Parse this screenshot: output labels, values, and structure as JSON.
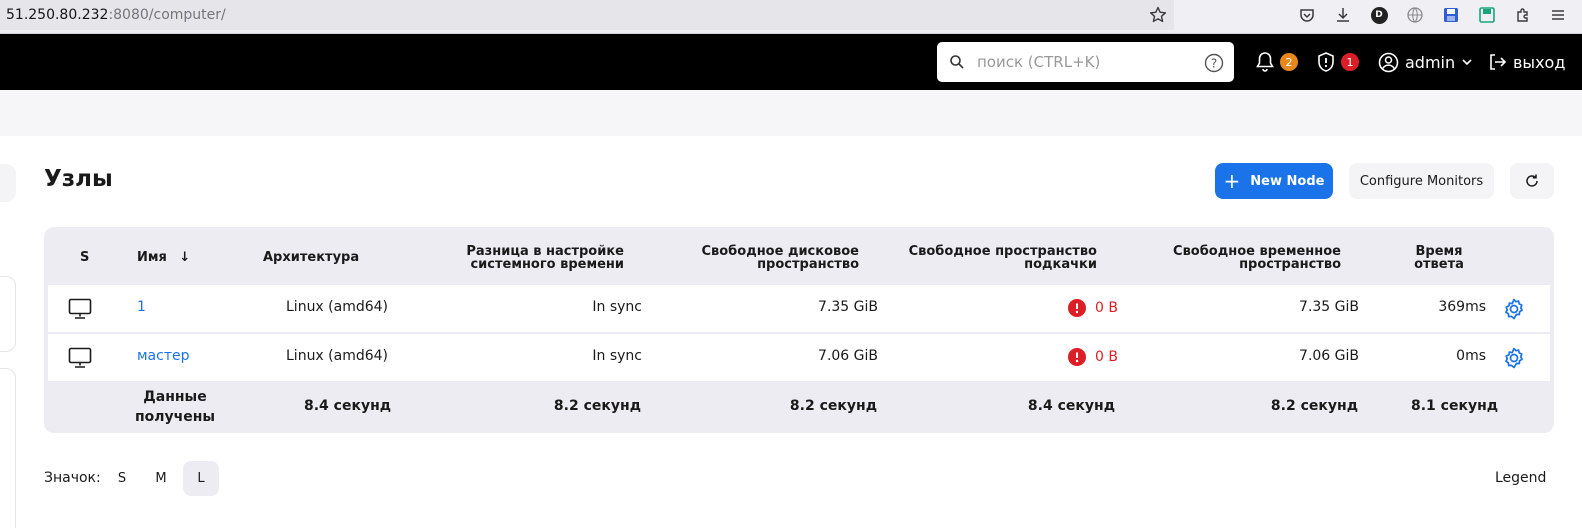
{
  "browser": {
    "url_host": "51.250.80.232",
    "url_rest": ":8080/computer/",
    "ext_d_label": "D"
  },
  "header": {
    "search_placeholder": "поиск (CTRL+K)",
    "notifications_count": "2",
    "security_count": "1",
    "user_label": "admin",
    "logout_label": "выход"
  },
  "page": {
    "title": "Узлы",
    "new_node_label": "New Node",
    "configure_monitors_label": "Configure Monitors"
  },
  "table": {
    "headers": {
      "status": "S",
      "name": "Имя",
      "sort_arrow": "↓",
      "architecture": "Архитектура",
      "clock_diff_1": "Разница в настройке",
      "clock_diff_2": "системного времени",
      "disk_1": "Свободное дисковое",
      "disk_2": "пространство",
      "swap_1": "Свободное пространство",
      "swap_2": "подкачки",
      "temp_1": "Свободное временное",
      "temp_2": "пространство",
      "response_1": "Время",
      "response_2": "ответа"
    },
    "rows": [
      {
        "name": "1",
        "architecture": "Linux (amd64)",
        "clock": "In sync",
        "disk": "7.35 GiB",
        "swap": "0 B",
        "temp": "7.35 GiB",
        "response": "369ms"
      },
      {
        "name": "мастер",
        "architecture": "Linux (amd64)",
        "clock": "In sync",
        "disk": "7.06 GiB",
        "swap": "0 B",
        "temp": "7.06 GiB",
        "response": "0ms"
      }
    ],
    "footer": {
      "label_1": "Данные",
      "label_2": "получены",
      "architecture": "8.4 секунд",
      "clock": "8.2 секунд",
      "disk": "8.2 секунд",
      "swap": "8.4 секунд",
      "temp": "8.2 секунд",
      "response": "8.1 секунд"
    }
  },
  "bottom": {
    "icon_size_label": "Значок:",
    "sizes": [
      "S",
      "M",
      "L"
    ],
    "active_size": "L",
    "legend_label": "Legend"
  },
  "colors": {
    "accent": "#1a73e8",
    "error": "#dc1f26",
    "badge_orange": "#e8871e",
    "header_bg": "#000000"
  }
}
